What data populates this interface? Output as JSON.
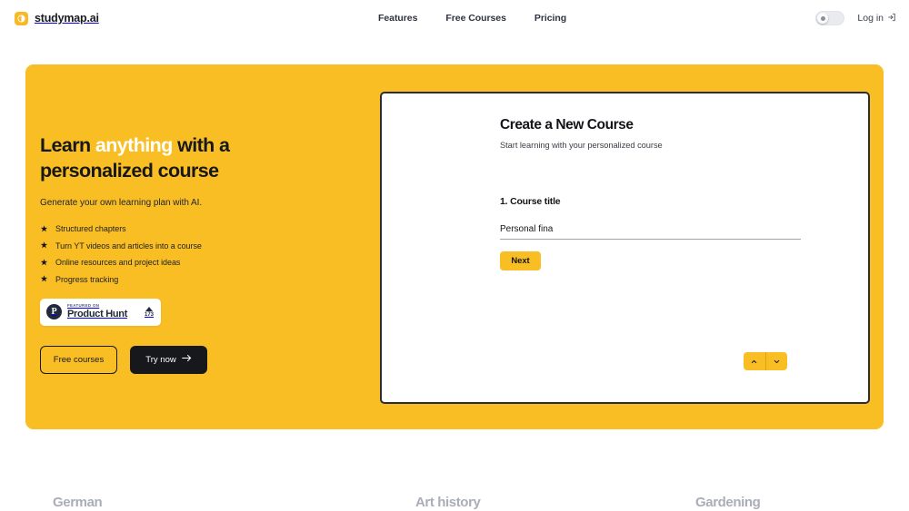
{
  "nav": {
    "brand": "studymap.ai",
    "brand_logo_icon": "contrast-circle-icon",
    "links": [
      {
        "label": "Features"
      },
      {
        "label": "Free Courses"
      },
      {
        "label": "Pricing"
      }
    ],
    "theme_toggle_icon": "sun-dot-icon",
    "login_label": "Log in",
    "login_icon": "login-arrow-icon"
  },
  "hero": {
    "accent_color": "#F9BE23",
    "title_part1": "Learn ",
    "title_highlight": "anything",
    "title_part2": " with a personalized course",
    "subtitle": "Generate your own learning plan with AI.",
    "features": [
      {
        "icon": "star-icon",
        "label": "Structured chapters"
      },
      {
        "icon": "star-icon",
        "label": "Turn YT videos and articles into a course"
      },
      {
        "icon": "star-icon",
        "label": "Online resources and project ideas"
      },
      {
        "icon": "star-icon",
        "label": "Progress tracking"
      }
    ],
    "product_hunt": {
      "logo_letter": "P",
      "kicker": "FEATURED ON",
      "name": "Product Hunt",
      "upvote_icon": "caret-up-icon",
      "votes": "173"
    },
    "cta": {
      "secondary_label": "Free courses",
      "primary_label": "Try now",
      "primary_icon": "arrow-right-icon"
    }
  },
  "course_card": {
    "title": "Create a New Course",
    "subtitle": "Start learning with your personalized course",
    "field_label": "1. Course title",
    "field_value": "Personal fina",
    "field_placeholder": "Course title",
    "next_label": "Next",
    "stepper": {
      "up_icon": "chevron-up-icon",
      "down_icon": "chevron-down-icon"
    }
  },
  "below_fold": {
    "items": [
      {
        "label": "German"
      },
      {
        "label": "Art history"
      },
      {
        "label": "Gardening"
      }
    ]
  }
}
